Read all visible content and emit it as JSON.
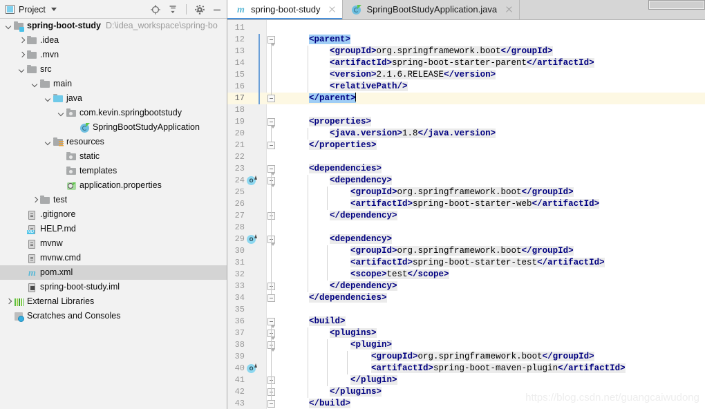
{
  "panel": {
    "title": "Project",
    "caret_icon": "chevron-down-icon",
    "project_icon": "project-view-icon",
    "toolbar": [
      {
        "name": "locate-icon",
        "label": "Select Opened File"
      },
      {
        "name": "collapse-all-icon",
        "label": "Collapse All"
      },
      {
        "name": "gear-icon",
        "label": "Settings"
      },
      {
        "name": "minimize-icon",
        "label": "Hide"
      }
    ]
  },
  "tree": [
    {
      "indent": 0,
      "toggle": "down",
      "icon": "module-folder-icon",
      "label": "spring-boot-study",
      "bold": true,
      "path": "D:\\idea_workspace\\spring-bo",
      "selected": false
    },
    {
      "indent": 1,
      "toggle": "right",
      "icon": "folder-icon",
      "label": ".idea",
      "bold": false,
      "path": "",
      "selected": false
    },
    {
      "indent": 1,
      "toggle": "right",
      "icon": "folder-icon",
      "label": ".mvn",
      "bold": false,
      "path": "",
      "selected": false
    },
    {
      "indent": 1,
      "toggle": "down",
      "icon": "folder-icon",
      "label": "src",
      "bold": false,
      "path": "",
      "selected": false
    },
    {
      "indent": 2,
      "toggle": "down",
      "icon": "folder-icon",
      "label": "main",
      "bold": false,
      "path": "",
      "selected": false
    },
    {
      "indent": 3,
      "toggle": "down",
      "icon": "source-root-folder-icon",
      "label": "java",
      "bold": false,
      "path": "",
      "selected": false
    },
    {
      "indent": 4,
      "toggle": "down",
      "icon": "package-icon",
      "label": "com.kevin.springbootstudy",
      "bold": false,
      "path": "",
      "selected": false
    },
    {
      "indent": 5,
      "toggle": "none",
      "icon": "spring-class-icon",
      "label": "SpringBootStudyApplication",
      "bold": false,
      "path": "",
      "selected": false
    },
    {
      "indent": 3,
      "toggle": "down",
      "icon": "resources-folder-icon",
      "label": "resources",
      "bold": false,
      "path": "",
      "selected": false
    },
    {
      "indent": 4,
      "toggle": "none",
      "icon": "package-icon",
      "label": "static",
      "bold": false,
      "path": "",
      "selected": false
    },
    {
      "indent": 4,
      "toggle": "none",
      "icon": "package-icon",
      "label": "templates",
      "bold": false,
      "path": "",
      "selected": false
    },
    {
      "indent": 4,
      "toggle": "none",
      "icon": "properties-file-icon",
      "label": "application.properties",
      "bold": false,
      "path": "",
      "selected": false
    },
    {
      "indent": 2,
      "toggle": "right",
      "icon": "folder-icon",
      "label": "test",
      "bold": false,
      "path": "",
      "selected": false
    },
    {
      "indent": 1,
      "toggle": "none",
      "icon": "text-file-icon",
      "label": ".gitignore",
      "bold": false,
      "path": "",
      "selected": false
    },
    {
      "indent": 1,
      "toggle": "none",
      "icon": "markdown-file-icon",
      "label": "HELP.md",
      "bold": false,
      "path": "",
      "selected": false
    },
    {
      "indent": 1,
      "toggle": "none",
      "icon": "text-file-icon",
      "label": "mvnw",
      "bold": false,
      "path": "",
      "selected": false
    },
    {
      "indent": 1,
      "toggle": "none",
      "icon": "text-file-icon",
      "label": "mvnw.cmd",
      "bold": false,
      "path": "",
      "selected": false
    },
    {
      "indent": 1,
      "toggle": "none",
      "icon": "maven-file-icon",
      "label": "pom.xml",
      "bold": false,
      "path": "",
      "selected": true
    },
    {
      "indent": 1,
      "toggle": "none",
      "icon": "iml-file-icon",
      "label": "spring-boot-study.iml",
      "bold": false,
      "path": "",
      "selected": false
    },
    {
      "indent": 0,
      "toggle": "right",
      "icon": "external-libraries-icon",
      "label": "External Libraries",
      "bold": false,
      "path": "",
      "selected": false
    },
    {
      "indent": 0,
      "toggle": "none",
      "icon": "scratches-icon",
      "label": "Scratches and Consoles",
      "bold": false,
      "path": "",
      "selected": false
    }
  ],
  "tabs": [
    {
      "label": "spring-boot-study",
      "icon": "maven-file-icon",
      "active": true
    },
    {
      "label": "SpringBootStudyApplication.java",
      "icon": "spring-class-icon",
      "active": false
    }
  ],
  "editor": {
    "current_line": 17,
    "first_line": 11,
    "lines": [
      {
        "n": 11,
        "code": ""
      },
      {
        "n": 12,
        "code": "    <parent>",
        "fold": "open",
        "sel": true
      },
      {
        "n": 13,
        "code": "        <groupId>org.springframework.boot</groupId>"
      },
      {
        "n": 14,
        "code": "        <artifactId>spring-boot-starter-parent</artifactId>"
      },
      {
        "n": 15,
        "code": "        <version>2.1.6.RELEASE</version>"
      },
      {
        "n": 16,
        "code": "        <relativePath/>"
      },
      {
        "n": 17,
        "code": "    </parent>",
        "fold": "close",
        "sel": true,
        "current": true,
        "caret": true
      },
      {
        "n": 18,
        "code": ""
      },
      {
        "n": 19,
        "code": "    <properties>",
        "fold": "open"
      },
      {
        "n": 20,
        "code": "        <java.version>1.8</java.version>"
      },
      {
        "n": 21,
        "code": "    </properties>",
        "fold": "close"
      },
      {
        "n": 22,
        "code": ""
      },
      {
        "n": 23,
        "code": "    <dependencies>",
        "fold": "open"
      },
      {
        "n": 24,
        "code": "        <dependency>",
        "fold": "open",
        "mvn": true
      },
      {
        "n": 25,
        "code": "            <groupId>org.springframework.boot</groupId>"
      },
      {
        "n": 26,
        "code": "            <artifactId>spring-boot-starter-web</artifactId>"
      },
      {
        "n": 27,
        "code": "        </dependency>",
        "fold": "close"
      },
      {
        "n": 28,
        "code": ""
      },
      {
        "n": 29,
        "code": "        <dependency>",
        "fold": "open",
        "mvn": true
      },
      {
        "n": 30,
        "code": "            <groupId>org.springframework.boot</groupId>"
      },
      {
        "n": 31,
        "code": "            <artifactId>spring-boot-starter-test</artifactId>"
      },
      {
        "n": 32,
        "code": "            <scope>test</scope>"
      },
      {
        "n": 33,
        "code": "        </dependency>",
        "fold": "close"
      },
      {
        "n": 34,
        "code": "    </dependencies>",
        "fold": "close"
      },
      {
        "n": 35,
        "code": ""
      },
      {
        "n": 36,
        "code": "    <build>",
        "fold": "open"
      },
      {
        "n": 37,
        "code": "        <plugins>",
        "fold": "open"
      },
      {
        "n": 38,
        "code": "            <plugin>",
        "fold": "open"
      },
      {
        "n": 39,
        "code": "                <groupId>org.springframework.boot</groupId>"
      },
      {
        "n": 40,
        "code": "                <artifactId>spring-boot-maven-plugin</artifactId>",
        "mvn": true
      },
      {
        "n": 41,
        "code": "            </plugin>",
        "fold": "close"
      },
      {
        "n": 42,
        "code": "        </plugins>",
        "fold": "close"
      },
      {
        "n": 43,
        "code": "    </build>",
        "fold": "close"
      }
    ]
  },
  "watermark": "https://blog.csdn.net/guangcaiwudong",
  "colors": {
    "tag": "#000080",
    "selection": "#9fcdf5",
    "current_line": "#fdf8e3",
    "tab_underline": "#4a90d9",
    "change_bar": "#6a9fd8",
    "tree_selection": "#d4d4d4"
  }
}
